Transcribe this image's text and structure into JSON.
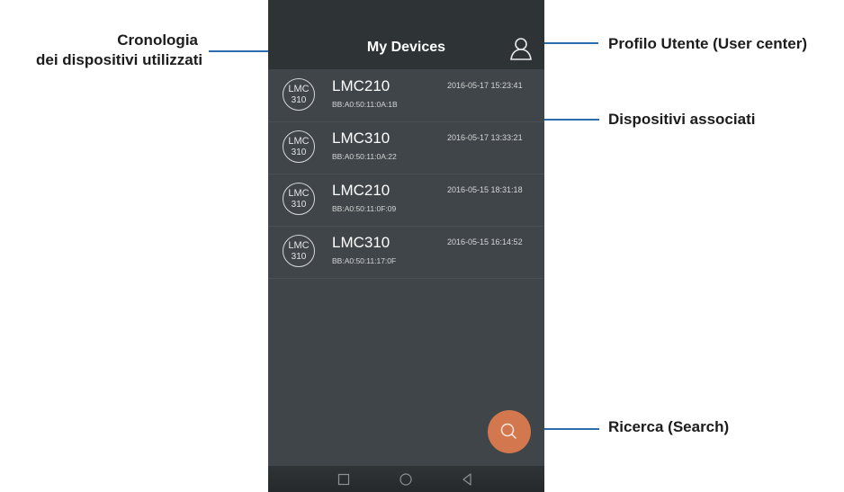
{
  "annotations": {
    "history": {
      "line1": "Cronologia",
      "line2": "dei dispositivi utilizzati"
    },
    "user_profile": "Profilo Utente (User center)",
    "associated": "Dispositivi associati",
    "search": "Ricerca (Search)"
  },
  "app": {
    "title": "My Devices",
    "devices": [
      {
        "badge_top": "LMC",
        "badge_bottom": "310",
        "name": "LMC210",
        "mac": "BB:A0:50:11:0A:1B",
        "time": "2016-05-17 15:23:41"
      },
      {
        "badge_top": "LMC",
        "badge_bottom": "310",
        "name": "LMC310",
        "mac": "BB:A0:50:11:0A:22",
        "time": "2016-05-17 13:33:21"
      },
      {
        "badge_top": "LMC",
        "badge_bottom": "310",
        "name": "LMC210",
        "mac": "BB:A0:50:11:0F:09",
        "time": "2016-05-15 18:31:18"
      },
      {
        "badge_top": "LMC",
        "badge_bottom": "310",
        "name": "LMC310",
        "mac": "BB:A0:50:11:17:0F",
        "time": "2016-05-15 16:14:52"
      }
    ]
  },
  "icons": {
    "user": "user-icon",
    "search": "search-icon",
    "nav": [
      "square-icon",
      "circle-icon",
      "triangle-back-icon"
    ]
  },
  "colors": {
    "accent": "#d3774f",
    "annotation_line": "#2d6dad",
    "app_bar": "#2e3336",
    "list_bg": "#3f4548"
  }
}
